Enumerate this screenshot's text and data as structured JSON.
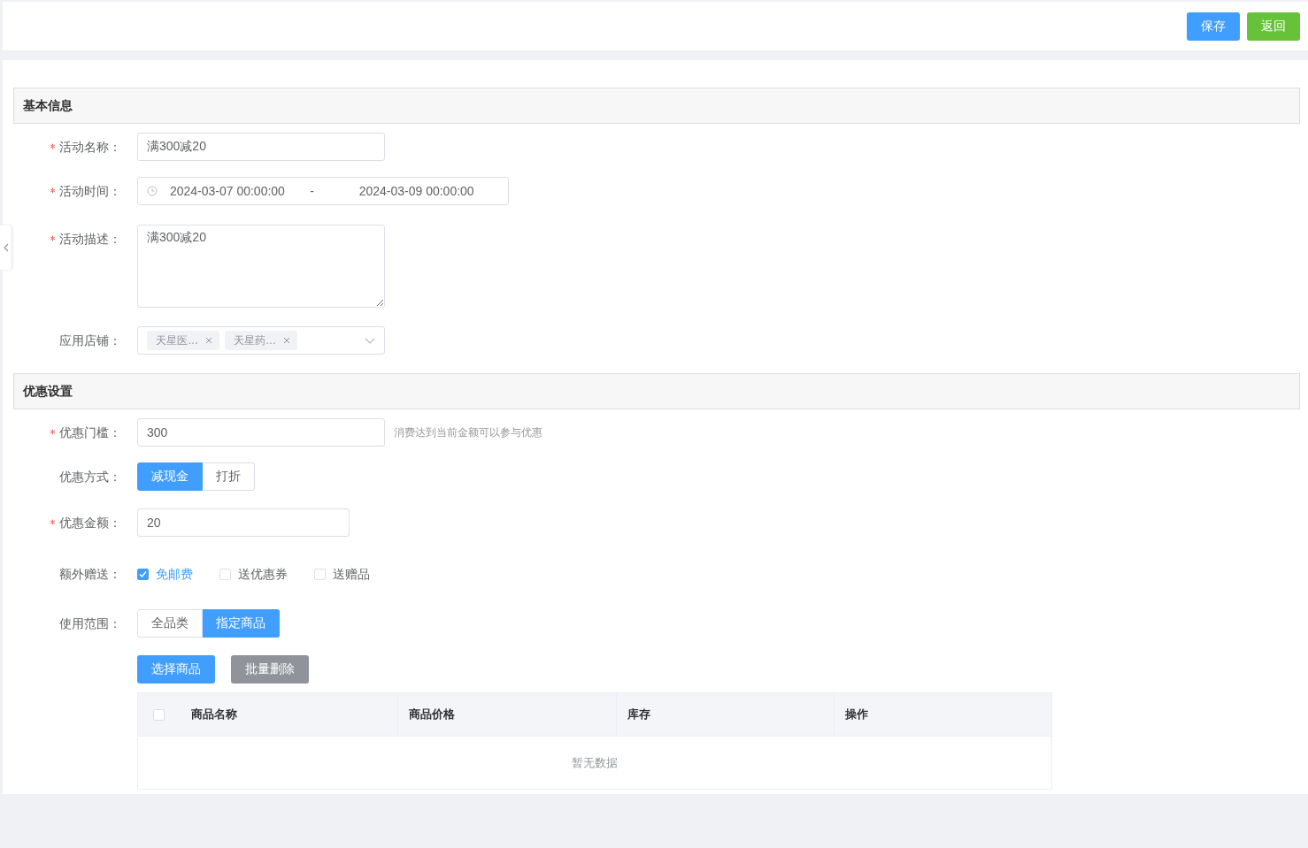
{
  "top_bar": {
    "buttons": [
      {
        "label": "保存",
        "kind": "primary"
      },
      {
        "label": "返回",
        "kind": "success"
      }
    ]
  },
  "sections": [
    {
      "title": "基本信息",
      "fields": [
        {
          "kind": "input",
          "label": "活动名称：",
          "required": true,
          "value": "满300减20"
        },
        {
          "kind": "daterange",
          "label": "活动时间：",
          "required": true,
          "start": "2024-03-07 00:00:00",
          "separator": "-",
          "end": "2024-03-09 00:00:00"
        },
        {
          "kind": "textarea",
          "label": "活动描述：",
          "required": true,
          "value": "满300减20"
        },
        {
          "kind": "tags",
          "label": "应用店铺：",
          "required": false,
          "tags": [
            "天星医…",
            "天星药…"
          ]
        }
      ]
    },
    {
      "title": "优惠设置",
      "fields": [
        {
          "kind": "input",
          "label": "优惠门槛：",
          "required": true,
          "value": "300",
          "hint": "消费达到当前金额可以参与优惠"
        },
        {
          "kind": "segmented",
          "label": "优惠方式：",
          "required": false,
          "options": [
            {
              "label": "减现金",
              "selected": true
            },
            {
              "label": "打折",
              "selected": false
            }
          ]
        },
        {
          "kind": "input",
          "label": "优惠金额：",
          "required": true,
          "value": "20"
        },
        {
          "kind": "checkboxes",
          "label": "额外赠送：",
          "required": false,
          "options": [
            {
              "label": "免邮费",
              "checked": true
            },
            {
              "label": "送优惠券",
              "checked": false
            },
            {
              "label": "送赠品",
              "checked": false
            }
          ]
        },
        {
          "kind": "segmented",
          "label": "使用范围：",
          "required": false,
          "options": [
            {
              "label": "全品类",
              "selected": false
            },
            {
              "label": "指定商品",
              "selected": true
            }
          ]
        },
        {
          "kind": "goods",
          "buttons": [
            {
              "label": "选择商品",
              "kind": "primary"
            },
            {
              "label": "批量删除",
              "kind": "muted"
            }
          ],
          "table": {
            "select_all": {
              "checked": false
            },
            "columns": [
              "商品名称",
              "商品价格",
              "库存",
              "操作"
            ],
            "empty_text": "暂无数据"
          }
        }
      ]
    }
  ]
}
